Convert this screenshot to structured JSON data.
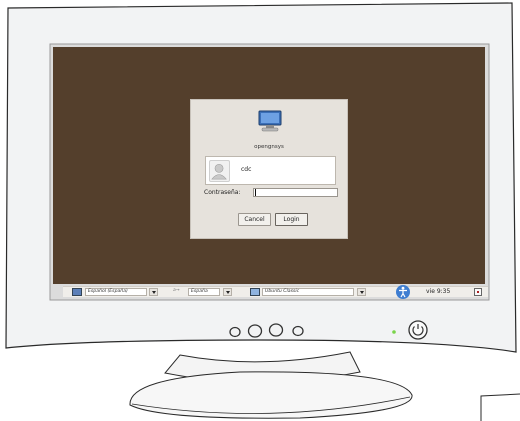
{
  "login": {
    "hostname": "opengnsys",
    "username": "cdc",
    "password_label": "Contraseña:",
    "password_value": "",
    "cancel_label": "Cancel",
    "login_label": "Login"
  },
  "panel": {
    "language": "Español (España)",
    "keyboard_prefix": "a→",
    "keyboard": "España",
    "session": "Ubuntu Classic",
    "clock": "vie  9:35"
  },
  "icons": {
    "computer": "computer-icon",
    "avatar": "user-avatar-icon",
    "accessibility": "accessibility-icon",
    "shutdown": "shutdown-icon",
    "power": "power-button-icon"
  },
  "colors": {
    "desktop_background": "#543f2c",
    "dialog_background": "#e6e2dc",
    "panel_background": "#f0eeea",
    "power_led": "#7ad44a"
  }
}
